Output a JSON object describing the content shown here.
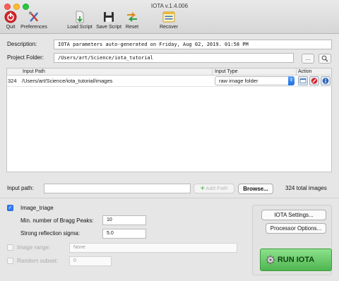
{
  "window": {
    "title": "IOTA v.1.4.006"
  },
  "toolbar": {
    "quit": "Quit",
    "preferences": "Preferences",
    "load_script": "Load Script",
    "save_script": "Save Script",
    "reset": "Reset",
    "recover": "Recover"
  },
  "description": {
    "label": "Description:",
    "value": "IOTA parameters auto-generated on Friday, Aug 02, 2019. 01:58 PM"
  },
  "project_folder": {
    "label": "Project Folder:",
    "value": "/Users/art/Science/iota_tutorial",
    "browse_label": "...",
    "search_icon": "magnifier-icon"
  },
  "table": {
    "headers": {
      "input_path": "Input Path",
      "input_type": "Input Type",
      "action": "Action"
    },
    "rows": [
      {
        "count": "324",
        "path": "/Users/art/Science/iota_tutorial/images",
        "type": "raw image folder"
      }
    ]
  },
  "input_path": {
    "label": "Input path:",
    "value": "",
    "add_label": "Add Path",
    "browse_label": "Browse...",
    "total": "324 total images"
  },
  "options": {
    "image_triage": {
      "label": "Image_triage",
      "checked": true
    },
    "min_bragg": {
      "label": "Min. number of Bragg Peaks:",
      "value": "10"
    },
    "strong_sigma": {
      "label": "Strong reflection sigma:",
      "value": "5.0"
    },
    "image_range": {
      "label": "Image range:",
      "value": "None",
      "checked": false
    },
    "random_subset": {
      "label": "Random subset:",
      "value": "0",
      "checked": false
    }
  },
  "buttons": {
    "iota_settings": "IOTA Settings...",
    "processor_options": "Processor Options...",
    "run": "RUN IOTA"
  },
  "colors": {
    "accent": "#2f7cf6",
    "run_green": "#4fb54f",
    "quit_red": "#d9262c"
  }
}
